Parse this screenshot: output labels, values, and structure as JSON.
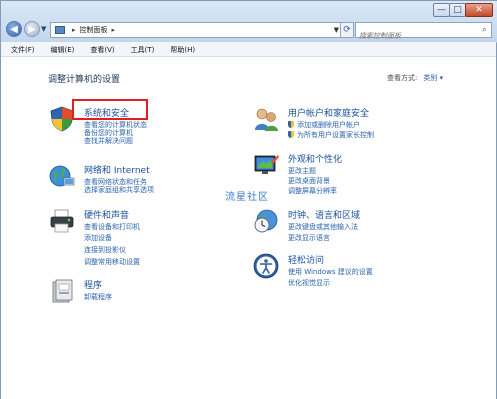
{
  "window": {
    "address_segments": [
      "控制面板"
    ],
    "search_placeholder": "搜索控制面板",
    "controls": {
      "minimize": "—",
      "maximize": "□",
      "close": "✕"
    }
  },
  "menu": [
    "文件(F)",
    "编辑(E)",
    "查看(V)",
    "工具(T)",
    "帮助(H)"
  ],
  "page": {
    "title": "调整计算机的设置",
    "view_by_label": "查看方式:",
    "view_by_value": "类别 ▾"
  },
  "categories": [
    {
      "title": "系统和安全",
      "icon": "security-shield-icon",
      "links": [
        "查看您的计算机状态",
        "备份您的计算机",
        "查找并解决问题"
      ]
    },
    {
      "title": "网络和 Internet",
      "icon": "network-globe-icon",
      "links": [
        "查看网络状态和任务",
        "选择家庭组和共享选项"
      ]
    },
    {
      "title": "硬件和声音",
      "icon": "printer-icon",
      "links": [
        "查看设备和打印机",
        "添加设备",
        "连接到投影仪",
        "调整常用移动设置"
      ]
    },
    {
      "title": "程序",
      "icon": "programs-icon",
      "links": [
        "卸载程序"
      ]
    },
    {
      "title": "用户帐户和家庭安全",
      "icon": "users-icon",
      "links": [
        "添加或删除用户帐户",
        "为所有用户设置家长控制"
      ]
    },
    {
      "title": "外观和个性化",
      "icon": "appearance-icon",
      "links": [
        "更改主题",
        "更改桌面背景",
        "调整屏幕分辨率"
      ]
    },
    {
      "title": "时钟、语言和区域",
      "icon": "clock-globe-icon",
      "links": [
        "更改键盘或其他输入法",
        "更改显示语言"
      ]
    },
    {
      "title": "轻松访问",
      "icon": "ease-of-access-icon",
      "links": [
        "使用 Windows 建议的设置",
        "优化视觉显示"
      ]
    }
  ],
  "watermark": "流星社区"
}
